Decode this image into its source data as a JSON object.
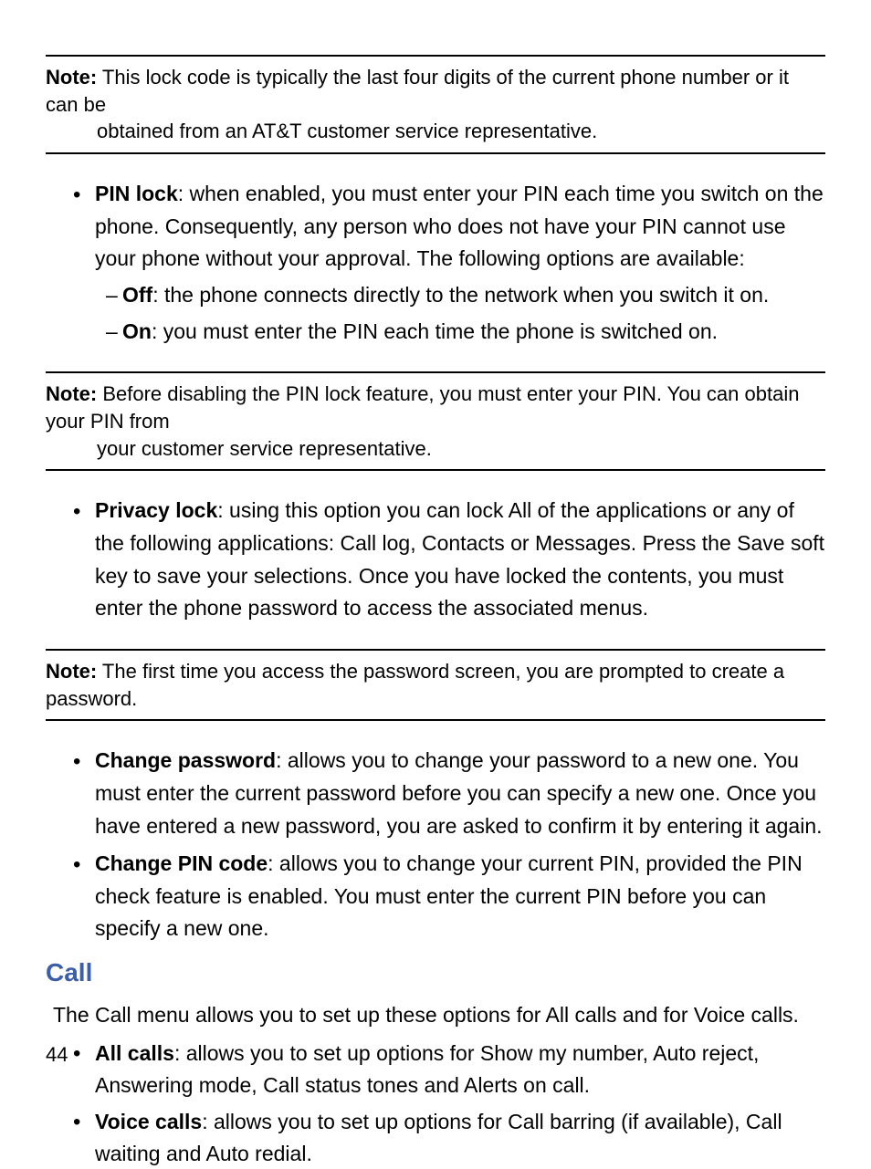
{
  "note1": {
    "label": "Note:",
    "line1": " This lock code is typically the last four digits of the current phone number or it can be",
    "line2": "obtained from an AT&T customer service representative."
  },
  "pinlock": {
    "title": "PIN lock",
    "desc": ": when enabled, you must enter your PIN each time you switch on the phone. Consequently, any person who does not have your PIN cannot use your phone without your approval. The following options are available:",
    "off_label": "Off",
    "off_desc": ": the phone connects directly to the network when you switch it on.",
    "on_label": "On",
    "on_desc": ": you must enter the PIN each time the phone is switched on."
  },
  "note2": {
    "label": "Note:",
    "line1": " Before disabling the PIN lock feature, you must enter your PIN. You can obtain your PIN from",
    "line2": "your customer service representative."
  },
  "privacylock": {
    "title": "Privacy lock",
    "desc": ": using this option you can lock All of the applications or any of the following applications: Call log, Contacts or Messages. Press the Save soft key to save your selections. Once you have locked the contents, you must enter the phone password to access the associated menus."
  },
  "note3": {
    "label": "Note:",
    "text": " The first time you access the password screen, you are prompted to create a password."
  },
  "changepw": {
    "title": "Change password",
    "desc": ": allows you to change your password to a new one. You must enter the current password before you can specify a new one. Once you have entered a new password, you are asked to confirm it by entering it again."
  },
  "changepin": {
    "title": "Change PIN code",
    "desc": ": allows you to change your current PIN, provided the PIN check feature is enabled. You must enter the current PIN before you can specify a new one."
  },
  "call": {
    "heading": "Call",
    "intro_pre": "The ",
    "intro_bold": "Call menu",
    "intro_post": " allows you to set up these options for All calls and for Voice calls.",
    "allcalls_title": "All calls",
    "allcalls_desc": ": allows you to set up options for Show my number, Auto reject, Answering mode, Call status tones and Alerts on call.",
    "voicecalls_title": "Voice calls",
    "voicecalls_desc": ": allows you to set up options for Call barring (if available), Call waiting and Auto redial."
  },
  "page_number": "44"
}
